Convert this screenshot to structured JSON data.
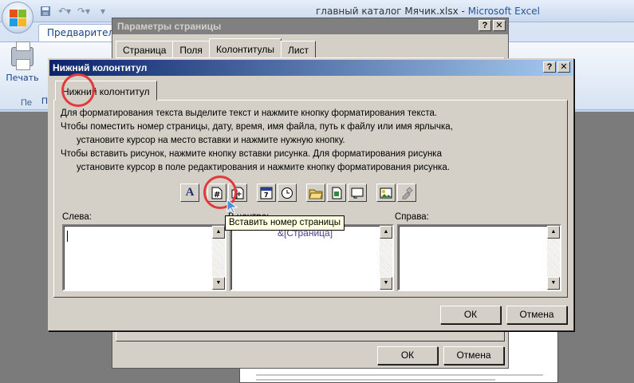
{
  "excel": {
    "title": "главный каталог Мячик.xlsx",
    "separator": " - ",
    "app_name": "Microsoft Excel",
    "ribbon_tab": "Предварительный просмотр",
    "print_label": "Печать",
    "print_label_2": "П",
    "group_label": "Пе",
    "qat_icons": [
      "save-icon",
      "undo-icon",
      "redo-icon",
      "customize-icon"
    ]
  },
  "page_setup": {
    "title": "Параметры страницы",
    "help": "?",
    "close": "✕",
    "tabs": [
      "Страница",
      "Поля",
      "Колонтитулы",
      "Лист"
    ],
    "active_tab": "Колонтитулы",
    "ok": "ОК",
    "cancel": "Отмена"
  },
  "footer_dialog": {
    "title": "Нижний колонтитул",
    "help": "?",
    "close": "✕",
    "tab": "Нижний колонтитул",
    "instructions": {
      "line1": "Для форматирования текста выделите текст и нажмите кнопку форматирования текста.",
      "line2": "Чтобы поместить номер страницы, дату, время, имя файла, путь к файлу или имя ярлычка,",
      "line3": "установите курсор на место вставки и нажмите нужную кнопку.",
      "line4": "Чтобы вставить рисунок, нажмите кнопку вставки рисунка.  Для форматирования рисунка",
      "line5": "установите курсор в поле редактирования и нажмите кнопку форматирования рисунка."
    },
    "toolbar": [
      {
        "name": "format-text-icon",
        "glyph": "A"
      },
      {
        "name": "insert-page-number-icon",
        "glyph": "#"
      },
      {
        "name": "insert-page-count-icon",
        "glyph": "+"
      },
      {
        "name": "insert-date-icon",
        "glyph": "7"
      },
      {
        "name": "insert-time-icon",
        "glyph": "◷"
      },
      {
        "name": "insert-file-path-icon",
        "glyph": ""
      },
      {
        "name": "insert-file-name-icon",
        "glyph": ""
      },
      {
        "name": "insert-sheet-name-icon",
        "glyph": ""
      },
      {
        "name": "insert-picture-icon",
        "glyph": ""
      },
      {
        "name": "format-picture-icon",
        "glyph": ""
      }
    ],
    "left_label": "Слева:",
    "center_label": "В центре:",
    "right_label": "Справа:",
    "center_value": "&[Страница]",
    "ok": "ОК",
    "cancel": "Отмена",
    "tooltip": "Вставить номер страницы"
  },
  "colors": {
    "annotation": "#e23a3a",
    "active_title": "#0a246a",
    "dialog_face": "#d4d0c8"
  }
}
